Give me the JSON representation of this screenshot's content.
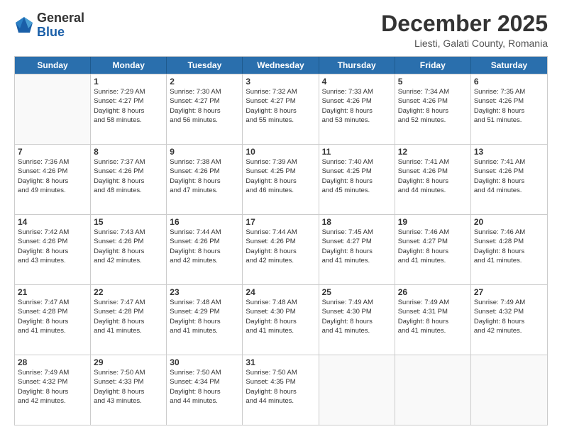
{
  "header": {
    "logo_general": "General",
    "logo_blue": "Blue",
    "main_title": "December 2025",
    "subtitle": "Liesti, Galati County, Romania"
  },
  "calendar": {
    "days_of_week": [
      "Sunday",
      "Monday",
      "Tuesday",
      "Wednesday",
      "Thursday",
      "Friday",
      "Saturday"
    ],
    "rows": [
      [
        {
          "day": "",
          "info": ""
        },
        {
          "day": "1",
          "info": "Sunrise: 7:29 AM\nSunset: 4:27 PM\nDaylight: 8 hours\nand 58 minutes."
        },
        {
          "day": "2",
          "info": "Sunrise: 7:30 AM\nSunset: 4:27 PM\nDaylight: 8 hours\nand 56 minutes."
        },
        {
          "day": "3",
          "info": "Sunrise: 7:32 AM\nSunset: 4:27 PM\nDaylight: 8 hours\nand 55 minutes."
        },
        {
          "day": "4",
          "info": "Sunrise: 7:33 AM\nSunset: 4:26 PM\nDaylight: 8 hours\nand 53 minutes."
        },
        {
          "day": "5",
          "info": "Sunrise: 7:34 AM\nSunset: 4:26 PM\nDaylight: 8 hours\nand 52 minutes."
        },
        {
          "day": "6",
          "info": "Sunrise: 7:35 AM\nSunset: 4:26 PM\nDaylight: 8 hours\nand 51 minutes."
        }
      ],
      [
        {
          "day": "7",
          "info": "Sunrise: 7:36 AM\nSunset: 4:26 PM\nDaylight: 8 hours\nand 49 minutes."
        },
        {
          "day": "8",
          "info": "Sunrise: 7:37 AM\nSunset: 4:26 PM\nDaylight: 8 hours\nand 48 minutes."
        },
        {
          "day": "9",
          "info": "Sunrise: 7:38 AM\nSunset: 4:26 PM\nDaylight: 8 hours\nand 47 minutes."
        },
        {
          "day": "10",
          "info": "Sunrise: 7:39 AM\nSunset: 4:25 PM\nDaylight: 8 hours\nand 46 minutes."
        },
        {
          "day": "11",
          "info": "Sunrise: 7:40 AM\nSunset: 4:25 PM\nDaylight: 8 hours\nand 45 minutes."
        },
        {
          "day": "12",
          "info": "Sunrise: 7:41 AM\nSunset: 4:26 PM\nDaylight: 8 hours\nand 44 minutes."
        },
        {
          "day": "13",
          "info": "Sunrise: 7:41 AM\nSunset: 4:26 PM\nDaylight: 8 hours\nand 44 minutes."
        }
      ],
      [
        {
          "day": "14",
          "info": "Sunrise: 7:42 AM\nSunset: 4:26 PM\nDaylight: 8 hours\nand 43 minutes."
        },
        {
          "day": "15",
          "info": "Sunrise: 7:43 AM\nSunset: 4:26 PM\nDaylight: 8 hours\nand 42 minutes."
        },
        {
          "day": "16",
          "info": "Sunrise: 7:44 AM\nSunset: 4:26 PM\nDaylight: 8 hours\nand 42 minutes."
        },
        {
          "day": "17",
          "info": "Sunrise: 7:44 AM\nSunset: 4:26 PM\nDaylight: 8 hours\nand 42 minutes."
        },
        {
          "day": "18",
          "info": "Sunrise: 7:45 AM\nSunset: 4:27 PM\nDaylight: 8 hours\nand 41 minutes."
        },
        {
          "day": "19",
          "info": "Sunrise: 7:46 AM\nSunset: 4:27 PM\nDaylight: 8 hours\nand 41 minutes."
        },
        {
          "day": "20",
          "info": "Sunrise: 7:46 AM\nSunset: 4:28 PM\nDaylight: 8 hours\nand 41 minutes."
        }
      ],
      [
        {
          "day": "21",
          "info": "Sunrise: 7:47 AM\nSunset: 4:28 PM\nDaylight: 8 hours\nand 41 minutes."
        },
        {
          "day": "22",
          "info": "Sunrise: 7:47 AM\nSunset: 4:28 PM\nDaylight: 8 hours\nand 41 minutes."
        },
        {
          "day": "23",
          "info": "Sunrise: 7:48 AM\nSunset: 4:29 PM\nDaylight: 8 hours\nand 41 minutes."
        },
        {
          "day": "24",
          "info": "Sunrise: 7:48 AM\nSunset: 4:30 PM\nDaylight: 8 hours\nand 41 minutes."
        },
        {
          "day": "25",
          "info": "Sunrise: 7:49 AM\nSunset: 4:30 PM\nDaylight: 8 hours\nand 41 minutes."
        },
        {
          "day": "26",
          "info": "Sunrise: 7:49 AM\nSunset: 4:31 PM\nDaylight: 8 hours\nand 41 minutes."
        },
        {
          "day": "27",
          "info": "Sunrise: 7:49 AM\nSunset: 4:32 PM\nDaylight: 8 hours\nand 42 minutes."
        }
      ],
      [
        {
          "day": "28",
          "info": "Sunrise: 7:49 AM\nSunset: 4:32 PM\nDaylight: 8 hours\nand 42 minutes."
        },
        {
          "day": "29",
          "info": "Sunrise: 7:50 AM\nSunset: 4:33 PM\nDaylight: 8 hours\nand 43 minutes."
        },
        {
          "day": "30",
          "info": "Sunrise: 7:50 AM\nSunset: 4:34 PM\nDaylight: 8 hours\nand 44 minutes."
        },
        {
          "day": "31",
          "info": "Sunrise: 7:50 AM\nSunset: 4:35 PM\nDaylight: 8 hours\nand 44 minutes."
        },
        {
          "day": "",
          "info": ""
        },
        {
          "day": "",
          "info": ""
        },
        {
          "day": "",
          "info": ""
        }
      ]
    ]
  }
}
